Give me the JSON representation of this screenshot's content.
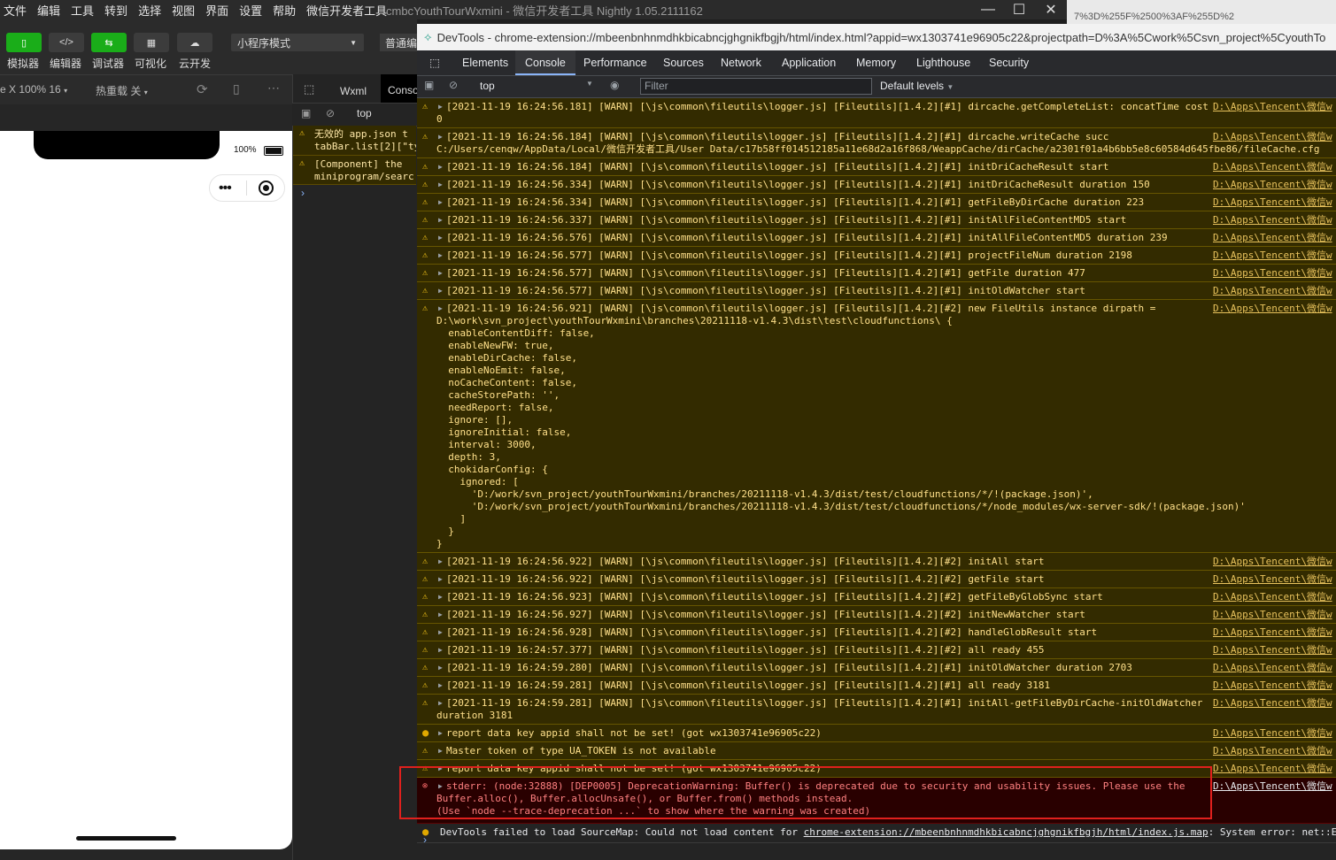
{
  "menu": [
    "文件",
    "编辑",
    "工具",
    "转到",
    "选择",
    "视图",
    "界面",
    "设置",
    "帮助",
    "微信开发者工具"
  ],
  "app_title": "cmbcYouthTourWxmini - 微信开发者工具 Nightly 1.05.2111162",
  "window_controls": {
    "minimize": "—",
    "maximize": "☐",
    "close": "✕"
  },
  "bg_url_fragment": "7%3D%255F%2500%3AF%255D%2",
  "toolbar": {
    "buttons": [
      {
        "label": "模拟器",
        "icon": "phone-icon"
      },
      {
        "label": "编辑器",
        "icon": "code-icon"
      },
      {
        "label": "调试器",
        "icon": "debug-icon"
      },
      {
        "label": "可视化",
        "icon": "layout-icon"
      },
      {
        "label": "云开发",
        "icon": "cloud-icon"
      }
    ],
    "mode": "小程序模式",
    "compile": "普通编译"
  },
  "sim_toolbar": {
    "device": "e X 100% 16",
    "hot_reload": "热重载 关"
  },
  "phone": {
    "battery": "100%"
  },
  "small_devtools": {
    "tabs": [
      "Wxml",
      "Conso"
    ],
    "context": "top",
    "messages": [
      {
        "line1": "无效的 app.json t",
        "line2": "tabBar.list[2][\"ty"
      },
      {
        "line1": "[Component] the",
        "line2": "miniprogram/searc"
      }
    ]
  },
  "devtools": {
    "title": "DevTools - chrome-extension://mbeenbnhnmdhkbicabncjghgnikfbgjh/html/index.html?appid=wx1303741e96905c22&projectpath=D%3A%5Cwork%5Csvn_project%5CyouthTo",
    "tabs": [
      "Elements",
      "Console",
      "Performance",
      "Sources",
      "Network",
      "Application",
      "Memory",
      "Lighthouse",
      "Security"
    ],
    "active_tab": "Console",
    "context": "top",
    "filter_placeholder": "Filter",
    "levels": "Default levels",
    "source_link": "D:\\Apps\\Tencent\\微信w",
    "messages": [
      {
        "type": "warn",
        "text": "[2021-11-19 16:24:56.181] [WARN] [\\js\\common\\fileutils\\logger.js] [Fileutils][1.4.2][#1] dircache.getCompleteList: concatTime cost",
        "body": "0"
      },
      {
        "type": "warn",
        "text": "[2021-11-19 16:24:56.184] [WARN] [\\js\\common\\fileutils\\logger.js] [Fileutils][1.4.2][#1] dircache.writeCache succ",
        "body": "C:/Users/cenqw/AppData/Local/微信开发者工具/User Data/c17b58ff014512185a11e68d2a16f868/WeappCache/dirCache/a2301f01a4b6bb5e8c60584d645fbe86/fileCache.cfg"
      },
      {
        "type": "warn",
        "text": "[2021-11-19 16:24:56.184] [WARN] [\\js\\common\\fileutils\\logger.js] [Fileutils][1.4.2][#1] initDriCacheResult start"
      },
      {
        "type": "warn",
        "text": "[2021-11-19 16:24:56.334] [WARN] [\\js\\common\\fileutils\\logger.js] [Fileutils][1.4.2][#1] initDriCacheResult duration 150"
      },
      {
        "type": "warn",
        "text": "[2021-11-19 16:24:56.334] [WARN] [\\js\\common\\fileutils\\logger.js] [Fileutils][1.4.2][#1] getFileByDirCache duration 223"
      },
      {
        "type": "warn",
        "text": "[2021-11-19 16:24:56.337] [WARN] [\\js\\common\\fileutils\\logger.js] [Fileutils][1.4.2][#1] initAllFileContentMD5 start"
      },
      {
        "type": "warn",
        "text": "[2021-11-19 16:24:56.576] [WARN] [\\js\\common\\fileutils\\logger.js] [Fileutils][1.4.2][#1] initAllFileContentMD5 duration 239"
      },
      {
        "type": "warn",
        "text": "[2021-11-19 16:24:56.577] [WARN] [\\js\\common\\fileutils\\logger.js] [Fileutils][1.4.2][#1] projectFileNum duration 2198"
      },
      {
        "type": "warn",
        "text": "[2021-11-19 16:24:56.577] [WARN] [\\js\\common\\fileutils\\logger.js] [Fileutils][1.4.2][#1] getFile duration 477"
      },
      {
        "type": "warn",
        "text": "[2021-11-19 16:24:56.577] [WARN] [\\js\\common\\fileutils\\logger.js] [Fileutils][1.4.2][#1] initOldWatcher start"
      },
      {
        "type": "warn",
        "text": "[2021-11-19 16:24:56.921] [WARN] [\\js\\common\\fileutils\\logger.js] [Fileutils][1.4.2][#2] new FileUtils instance dirpath =",
        "body": "D:\\work\\svn_project\\youthTourWxmini\\branches\\20211118-v1.4.3\\dist\\test\\cloudfunctions\\ {\n  enableContentDiff: false,\n  enableNewFW: true,\n  enableDirCache: false,\n  enableNoEmit: false,\n  noCacheContent: false,\n  cacheStorePath: '',\n  needReport: false,\n  ignore: [],\n  ignoreInitial: false,\n  interval: 3000,\n  depth: 3,\n  chokidarConfig: {\n    ignored: [\n      'D:/work/svn_project/youthTourWxmini/branches/20211118-v1.4.3/dist/test/cloudfunctions/*/!(package.json)',\n      'D:/work/svn_project/youthTourWxmini/branches/20211118-v1.4.3/dist/test/cloudfunctions/*/node_modules/wx-server-sdk/!(package.json)'\n    ]\n  }\n}"
      },
      {
        "type": "warn",
        "text": "[2021-11-19 16:24:56.922] [WARN] [\\js\\common\\fileutils\\logger.js] [Fileutils][1.4.2][#2] initAll start"
      },
      {
        "type": "warn",
        "text": "[2021-11-19 16:24:56.922] [WARN] [\\js\\common\\fileutils\\logger.js] [Fileutils][1.4.2][#2] getFile start"
      },
      {
        "type": "warn",
        "text": "[2021-11-19 16:24:56.923] [WARN] [\\js\\common\\fileutils\\logger.js] [Fileutils][1.4.2][#2] getFileByGlobSync start"
      },
      {
        "type": "warn",
        "text": "[2021-11-19 16:24:56.927] [WARN] [\\js\\common\\fileutils\\logger.js] [Fileutils][1.4.2][#2] initNewWatcher start"
      },
      {
        "type": "warn",
        "text": "[2021-11-19 16:24:56.928] [WARN] [\\js\\common\\fileutils\\logger.js] [Fileutils][1.4.2][#2] handleGlobResult start"
      },
      {
        "type": "warn",
        "text": "[2021-11-19 16:24:57.377] [WARN] [\\js\\common\\fileutils\\logger.js] [Fileutils][1.4.2][#2] all ready 455"
      },
      {
        "type": "warn",
        "text": "[2021-11-19 16:24:59.280] [WARN] [\\js\\common\\fileutils\\logger.js] [Fileutils][1.4.2][#1] initOldWatcher duration 2703"
      },
      {
        "type": "warn",
        "text": "[2021-11-19 16:24:59.281] [WARN] [\\js\\common\\fileutils\\logger.js] [Fileutils][1.4.2][#1] all ready 3181"
      },
      {
        "type": "warn",
        "text": "[2021-11-19 16:24:59.281] [WARN] [\\js\\common\\fileutils\\logger.js] [Fileutils][1.4.2][#1] initAll-getFileByDirCache-initOldWatcher",
        "body": "duration 3181"
      },
      {
        "type": "warn2",
        "text": "report data key appid shall not be set! (got wx1303741e96905c22)"
      },
      {
        "type": "warn",
        "text": "Master token of type UA_TOKEN is not available"
      },
      {
        "type": "warn",
        "text": "report data key appid shall not be set! (got wx1303741e96905c22)"
      },
      {
        "type": "error",
        "text": "stderr: (node:32888) [DEP0005] DeprecationWarning: Buffer() is deprecated due to security and usability issues. Please use the",
        "body": "Buffer.alloc(), Buffer.allocUnsafe(), or Buffer.from() methods instead.\n(Use `node --trace-deprecation ...` to show where the warning was created)"
      },
      {
        "type": "sourcemap",
        "text": "DevTools failed to load SourceMap: Could not load content for ",
        "link": "chrome-extension://mbeenbnhnmdhkbicabncjghgnikfbgjh/html/index.js.map",
        "tail": ": System error: net::E"
      }
    ]
  }
}
